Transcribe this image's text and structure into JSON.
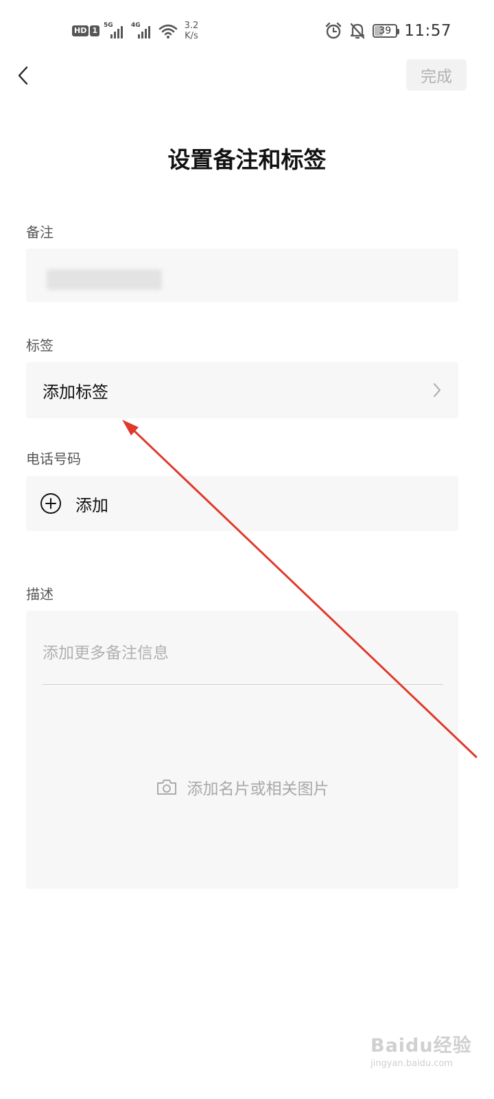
{
  "status_bar": {
    "hd_label": "HD",
    "sim_label": "1",
    "net1": "5G",
    "net2": "4G",
    "speed_value": "3.2",
    "speed_unit": "K/s",
    "battery": "39",
    "time": "11:57",
    "icons": [
      "alarm-icon",
      "mute-icon",
      "wifi-icon",
      "signal-icon",
      "battery-icon"
    ]
  },
  "nav": {
    "done_label": "完成"
  },
  "page": {
    "title": "设置备注和标签"
  },
  "remark": {
    "label": "备注",
    "value": ""
  },
  "tags": {
    "label": "标签",
    "add_label": "添加标签"
  },
  "phone": {
    "label": "电话号码",
    "add_label": "添加"
  },
  "description": {
    "label": "描述",
    "placeholder": "添加更多备注信息",
    "add_photo_label": "添加名片或相关图片"
  },
  "watermark": {
    "logo": "Baidu经验",
    "url": "jingyan.baidu.com"
  },
  "colors": {
    "annotation_arrow": "#e0392b",
    "field_background": "#f7f7f7",
    "done_disabled_text": "#b2b2b2"
  }
}
